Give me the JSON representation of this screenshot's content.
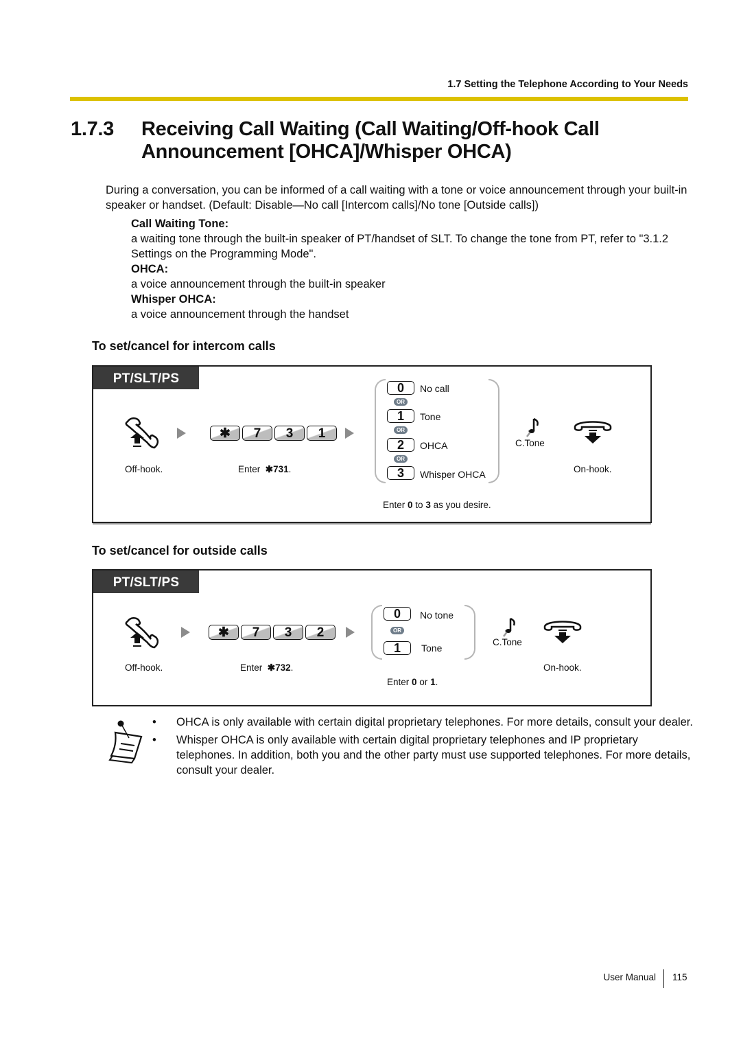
{
  "header": {
    "running_title": "1.7 Setting the Telephone According to Your Needs",
    "accent_color": "#dcc100"
  },
  "section": {
    "number": "1.7.3",
    "title": "Receiving Call Waiting (Call Waiting/Off-hook Call Announcement [OHCA]/Whisper OHCA)"
  },
  "intro": "During a conversation, you can be informed of a call waiting with a tone or voice announcement through your built-in speaker or handset. (Default: Disable—No call [Intercom calls]/No tone [Outside calls])",
  "definitions": [
    {
      "term": "Call Waiting Tone:",
      "desc": "a waiting tone through the built-in speaker of PT/handset of SLT. To change the tone from PT, refer to \"3.1.2 Settings on the Programming Mode\"."
    },
    {
      "term": "OHCA:",
      "desc": "a voice announcement through the built-in speaker"
    },
    {
      "term": "Whisper OHCA:",
      "desc": "a voice announcement through the handset"
    }
  ],
  "procedures": [
    {
      "heading": "To set/cancel for intercom calls",
      "tag": "PT/SLT/PS",
      "offhook_label": "Off-hook.",
      "keys": [
        "✱",
        "7",
        "3",
        "1"
      ],
      "enter_prefix": "Enter",
      "enter_code": "✱731",
      "enter_suffix": ".",
      "options": [
        {
          "key": "0",
          "label": "No call"
        },
        {
          "key": "1",
          "label": "Tone"
        },
        {
          "key": "2",
          "label": "OHCA"
        },
        {
          "key": "3",
          "label": "Whisper OHCA"
        }
      ],
      "or_label": "OR",
      "choice_note": {
        "prefix": "Enter ",
        "from": "0",
        "mid": " to ",
        "to": "3",
        "suffix": " as you desire."
      },
      "tone_label": "C.Tone",
      "onhook_label": "On-hook."
    },
    {
      "heading": "To set/cancel for outside calls",
      "tag": "PT/SLT/PS",
      "offhook_label": "Off-hook.",
      "keys": [
        "✱",
        "7",
        "3",
        "2"
      ],
      "enter_prefix": "Enter",
      "enter_code": "✱732",
      "enter_suffix": ".",
      "options": [
        {
          "key": "0",
          "label": "No tone"
        },
        {
          "key": "1",
          "label": "Tone"
        }
      ],
      "or_label": "OR",
      "choice_note": {
        "prefix": "Enter ",
        "from": "0",
        "mid": " or ",
        "to": "1",
        "suffix": "."
      },
      "tone_label": "C.Tone",
      "onhook_label": "On-hook."
    }
  ],
  "notes": [
    "OHCA is only available with certain digital proprietary telephones. For more details, consult your dealer.",
    "Whisper OHCA is only available with certain digital proprietary telephones and IP proprietary telephones. In addition, both you and the other party must use supported telephones. For more details, consult your dealer."
  ],
  "note_bullet": "•",
  "footer": {
    "label": "User Manual",
    "page": "115"
  }
}
